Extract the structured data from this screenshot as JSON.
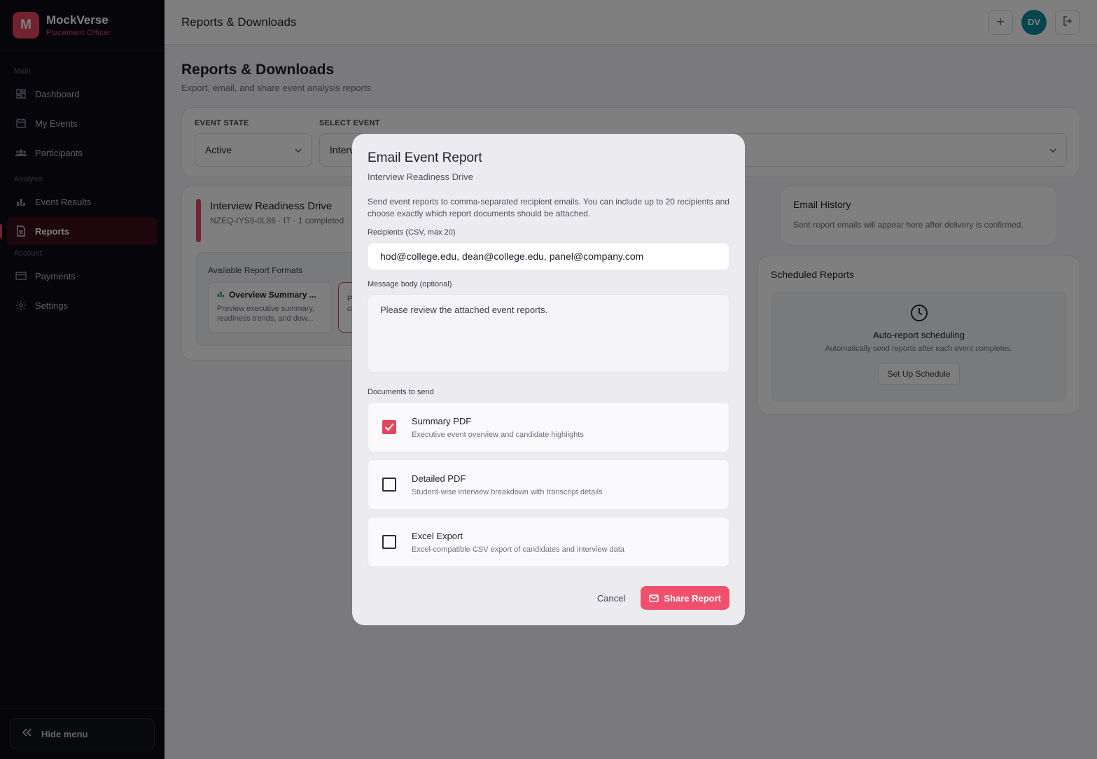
{
  "brand": {
    "initial": "M",
    "name": "MockVerse",
    "role": "Placement Officer"
  },
  "sidebar": {
    "sections": {
      "main": "Main",
      "analysis": "Analysis",
      "account": "Account"
    },
    "items": [
      {
        "label": "Dashboard",
        "icon": "dashboard-icon"
      },
      {
        "label": "My Events",
        "icon": "calendar-icon"
      },
      {
        "label": "Participants",
        "icon": "users-icon"
      },
      {
        "label": "Event Results",
        "icon": "bar-chart-icon"
      },
      {
        "label": "Reports",
        "icon": "document-icon"
      },
      {
        "label": "Payments",
        "icon": "credit-card-icon"
      },
      {
        "label": "Settings",
        "icon": "gear-icon"
      }
    ],
    "active": "Reports",
    "hide_menu": "Hide menu"
  },
  "topbar": {
    "title": "Reports & Downloads",
    "avatar": "DV"
  },
  "main": {
    "title": "Reports & Downloads",
    "subtitle": "Export, email, and share event analysis reports",
    "filters": {
      "event_state_label": "EVENT STATE",
      "event_state_value": "Active",
      "select_event_label": "SELECT EVENT",
      "select_event_value": "Interv"
    },
    "event": {
      "name": "Interview Readiness Drive",
      "meta": "NZEQ-IYS9-0L86 · IT · 1 completed",
      "formats_title": "Available Report Formats",
      "formats": [
        {
          "title": "Overview Summary ...",
          "desc": "Preview executive summary, readiness trends, and dow..."
        },
        {
          "title": "",
          "desc": "P ca"
        }
      ]
    },
    "history": {
      "title": "Email History",
      "desc": "Sent report emails will appear here after delivery is confirmed."
    },
    "scheduled": {
      "title": "Scheduled Reports",
      "heading": "Auto-report scheduling",
      "desc": "Automatically send reports after each event completes.",
      "button": "Set Up Schedule"
    }
  },
  "modal": {
    "title": "Email Event Report",
    "subtitle": "Interview Readiness Drive",
    "description": "Send event reports to comma-separated recipient emails. You can include up to 20 recipients and choose exactly which report documents should be attached.",
    "recipients_label": "Recipients (CSV, max 20)",
    "recipients_value": "hod@college.edu, dean@college.edu, panel@company.com",
    "message_label": "Message body (optional)",
    "message_value": "Please review the attached event reports.",
    "documents_label": "Documents to send",
    "documents": [
      {
        "title": "Summary PDF",
        "desc": "Executive event overview and candidate highlights",
        "checked": true
      },
      {
        "title": "Detailed PDF",
        "desc": "Student-wise interview breakdown with transcript details",
        "checked": false
      },
      {
        "title": "Excel Export",
        "desc": "Excel-compatible CSV export of candidates and interview data",
        "checked": false
      }
    ],
    "cancel": "Cancel",
    "share": "Share Report"
  },
  "colors": {
    "accent": "#e2465e",
    "share_button": "#f0506b",
    "avatar": "#0d8a9e",
    "sidebar_bg": "#0c0d14"
  }
}
